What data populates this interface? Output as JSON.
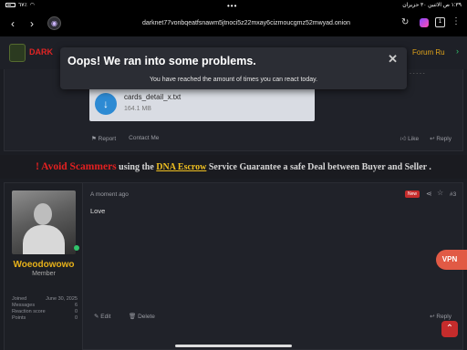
{
  "statusbar": {
    "battery": "٦٧٪",
    "datetime": "١:٣٩ ص  الاثنين ٣٠ حزيران",
    "dots": "•••"
  },
  "browser": {
    "url": "darknet77vonbqeatfsnawm5jtnoci5z22mxay6cizmoucgmz52mwyad.onion",
    "back": "‹",
    "forward": "›",
    "tab_count": "1"
  },
  "site": {
    "logo_text_red": "DARK",
    "forum_rules": "Forum Ru"
  },
  "popup": {
    "title": "Oops! We ran into some problems.",
    "message": "You have reached the amount of times you can react today.",
    "close": "✕"
  },
  "post1": {
    "attachment_name": "cards_detail_x.txt",
    "attachment_size": "164.1 MB",
    "report": "Report",
    "contact": "Contact Me",
    "like": "Like",
    "reply": "Reply"
  },
  "banner": {
    "warning": "! Avoid Scammers",
    "using": "using the",
    "escrow": "DNA Escrow",
    "rest": "Service Guarantee a safe Deal between Buyer and Seller ."
  },
  "post2": {
    "username": "Woeodowowo",
    "role": "Member",
    "stats": [
      {
        "label": "Joined",
        "value": "June 30, 2025"
      },
      {
        "label": "Messages",
        "value": "6"
      },
      {
        "label": "Reaction score",
        "value": "0"
      },
      {
        "label": "Points",
        "value": "0"
      }
    ],
    "date": "A moment ago",
    "badge": "New",
    "post_number": "#3",
    "body": "Love",
    "edit": "Edit",
    "delete": "Delete",
    "reply": "Reply"
  },
  "floating": {
    "vpn": "VPN"
  },
  "colors": {
    "accent_gold": "#e8b21a",
    "danger_red": "#c52c2c",
    "online_green": "#31c46b"
  }
}
